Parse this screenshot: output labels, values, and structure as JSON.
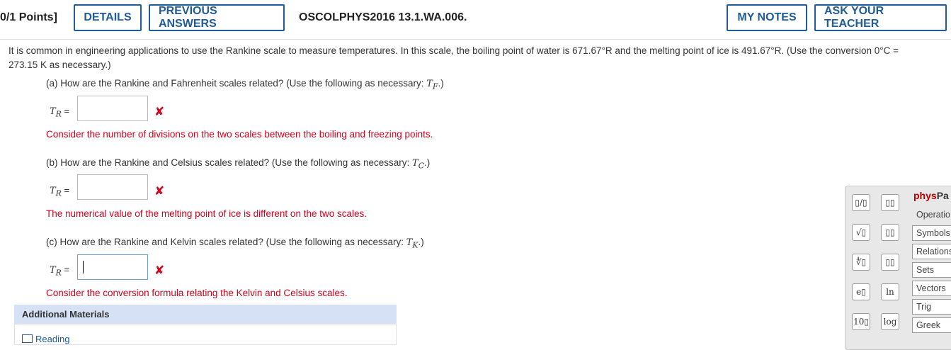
{
  "header": {
    "points": "0/1 Points]",
    "details": "DETAILS",
    "previous_answers": "PREVIOUS ANSWERS",
    "question_id": "OSCOLPHYS2016 13.1.WA.006.",
    "my_notes": "MY NOTES",
    "ask_teacher": "ASK YOUR TEACHER"
  },
  "intro": "It is common in engineering applications to use the Rankine scale to measure temperatures. In this scale, the boiling point of water is 671.67°R and the melting point of ice is 491.67°R. (Use the conversion 0°C = 273.15 K as necessary.)",
  "parts": [
    {
      "prompt": "(a) How are the Rankine and Fahrenheit scales related? (Use the following as necessary: ",
      "var": "T",
      "sub": "F",
      "suffix": ".)",
      "lhs_var": "T",
      "lhs_sub": "R",
      "eq": "=",
      "value": "",
      "hint": "Consider the number of divisions on the two scales between the boiling and freezing points."
    },
    {
      "prompt": "(b) How are the Rankine and Celsius scales related? (Use the following as necessary: ",
      "var": "T",
      "sub": "C",
      "suffix": ".)",
      "lhs_var": "T",
      "lhs_sub": "R",
      "eq": "=",
      "value": "",
      "hint": "The numerical value of the melting point of ice is different on the two scales."
    },
    {
      "prompt": "(c) How are the Rankine and Kelvin scales related? (Use the following as necessary: ",
      "var": "T",
      "sub": "K",
      "suffix": ".)",
      "lhs_var": "T",
      "lhs_sub": "R",
      "eq": "=",
      "value": "",
      "hint": "Consider the conversion formula relating the Kelvin and Celsius scales."
    }
  ],
  "wrong_mark": "✘",
  "additional_materials": {
    "title": "Additional Materials",
    "reading": "Reading"
  },
  "physpad": {
    "brand_a": "phys",
    "brand_b": "Pa",
    "tabs": [
      "Operatio",
      "Symbols",
      "Relations",
      "Sets",
      "Vectors",
      "Trig",
      "Greek"
    ],
    "buttons": {
      "fraction": "▯/▯",
      "superscript": "▯▯",
      "sqrt": "√▯",
      "subscript": "▯▯",
      "nthroot": "∜▯",
      "matrix": "▯▯",
      "exp": "e▯",
      "ln": "ln",
      "pow10": "10▯",
      "log": "log"
    }
  }
}
